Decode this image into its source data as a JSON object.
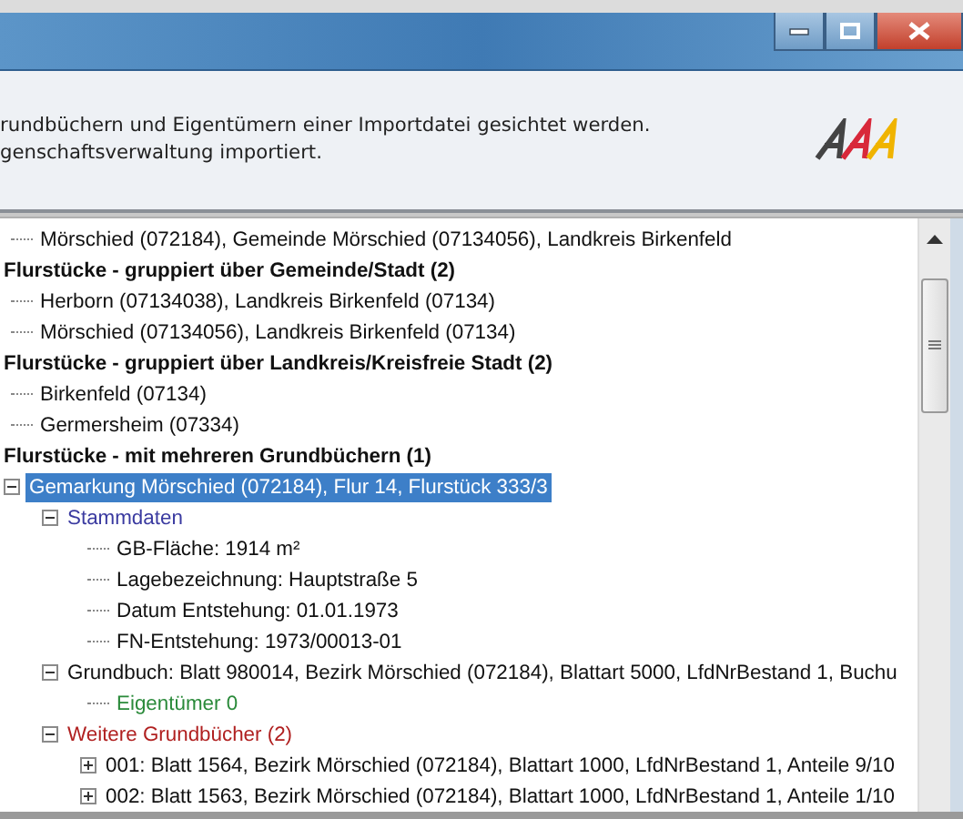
{
  "header": {
    "lines": [
      "rundbüchern und Eigentümern einer Importdatei gesichtet werden.",
      "genschaftsverwaltung importiert."
    ]
  },
  "tree": [
    {
      "kind": "group",
      "children": [
        {
          "label": "Mörschied (072184), Gemeinde Mörschied (07134056), Landkreis Birkenfeld",
          "selected": false
        }
      ]
    },
    {
      "kind": "group",
      "label": "Flurstücke - gruppiert über Gemeinde/Stadt (2)",
      "children": [
        {
          "label": "Herborn (07134038), Landkreis Birkenfeld (07134)",
          "selected": false
        },
        {
          "label": "Mörschied (07134056), Landkreis Birkenfeld (07134)",
          "selected": false
        }
      ]
    },
    {
      "kind": "group",
      "label": "Flurstücke - gruppiert über Landkreis/Kreisfreie Stadt (2)",
      "children": [
        {
          "label": "Birkenfeld (07134)",
          "selected": false
        },
        {
          "label": "Germersheim (07334)",
          "selected": false
        }
      ]
    },
    {
      "kind": "group",
      "label": "Flurstücke - mit mehreren Grundbüchern (1)",
      "children": [
        {
          "label": "Gemarkung Mörschied (072184), Flur 14, Flurstück 333/3",
          "selected": true,
          "expanded": true,
          "children": [
            {
              "label": "Stammdaten",
              "color": "#3a3aa0",
              "selected": false,
              "expanded": true,
              "children": [
                {
                  "label": "GB-Fläche: 1914 m²",
                  "selected": false
                },
                {
                  "label": "Lagebezeichnung: Hauptstraße 5",
                  "selected": false
                },
                {
                  "label": "Datum Entstehung: 01.01.1973",
                  "selected": false
                },
                {
                  "label": "FN-Entstehung: 1973/00013-01",
                  "selected": false
                }
              ]
            },
            {
              "label": "Grundbuch: Blatt 980014, Bezirk Mörschied (072184), Blattart 5000, LfdNrBestand 1, Buchu",
              "selected": false,
              "expanded": true,
              "children": [
                {
                  "label": "Eigentümer 0",
                  "color": "#2a8a3a",
                  "selected": false
                }
              ]
            },
            {
              "label": "Weitere Grundbücher (2)",
              "color": "#b02020",
              "selected": false,
              "expanded": true,
              "children": [
                {
                  "label": "001: Blatt 1564, Bezirk Mörschied (072184), Blattart 1000, LfdNrBestand 1, Anteile 9/10",
                  "selected": false,
                  "expanded": false
                },
                {
                  "label": "002: Blatt 1563, Bezirk Mörschied (072184), Blattart 1000, LfdNrBestand 1, Anteile 1/10",
                  "selected": false,
                  "expanded": false
                }
              ]
            }
          ]
        }
      ]
    }
  ]
}
